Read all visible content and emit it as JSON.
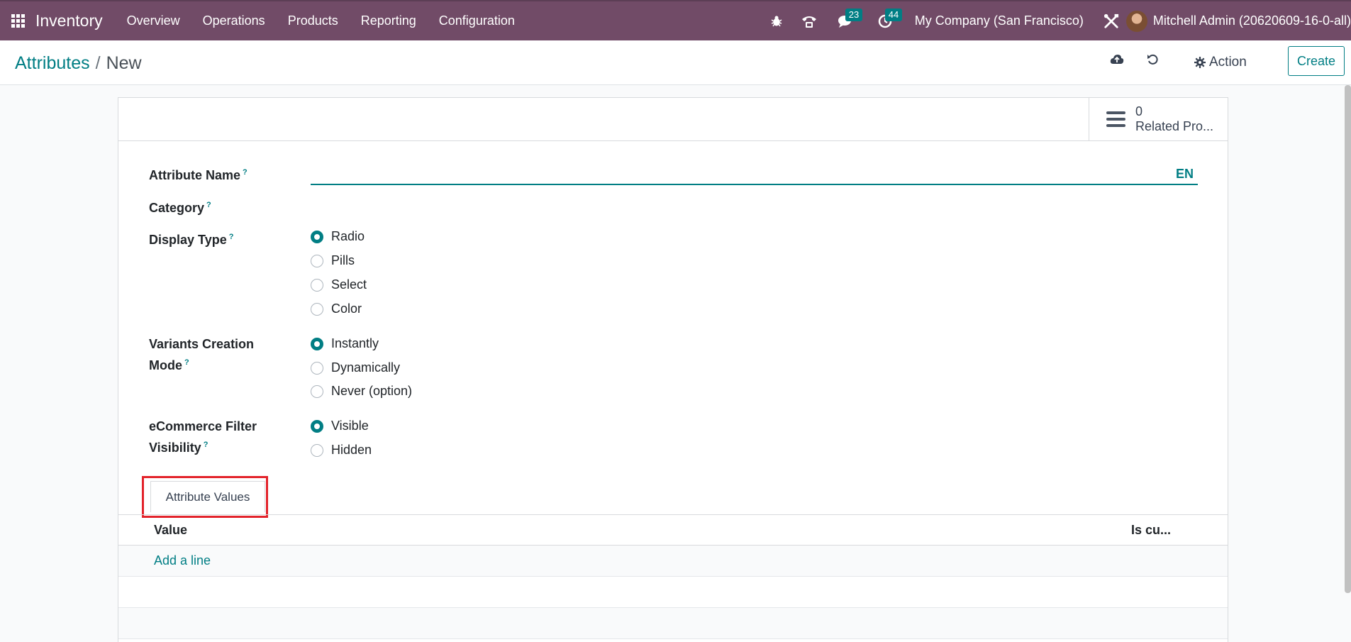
{
  "navbar": {
    "app_name": "Inventory",
    "menu": [
      "Overview",
      "Operations",
      "Products",
      "Reporting",
      "Configuration"
    ],
    "messages_count": "23",
    "activities_count": "44",
    "company": "My Company (San Francisco)",
    "user": "Mitchell Admin (20620609-16-0-all)"
  },
  "control_panel": {
    "breadcrumb_parent": "Attributes",
    "breadcrumb_separator": "/",
    "breadcrumb_current": "New",
    "action_label": "Action",
    "create_label": "Create"
  },
  "smart_button": {
    "count": "0",
    "label": "Related Pro..."
  },
  "form": {
    "attribute_name_label": "Attribute Name",
    "help_mark": "?",
    "lang": "EN",
    "category_label": "Category",
    "display_type_label": "Display Type",
    "display_type_options": [
      "Radio",
      "Pills",
      "Select",
      "Color"
    ],
    "display_type_selected": "Radio",
    "variants_label_line1": "Variants Creation",
    "variants_label_line2": "Mode",
    "variants_options": [
      "Instantly",
      "Dynamically",
      "Never (option)"
    ],
    "variants_selected": "Instantly",
    "ecommerce_label_line1": "eCommerce Filter",
    "ecommerce_label_line2": "Visibility",
    "ecommerce_options": [
      "Visible",
      "Hidden"
    ],
    "ecommerce_selected": "Visible"
  },
  "tabs": {
    "attribute_values": "Attribute Values"
  },
  "list": {
    "columns": [
      "Value",
      "Is cu..."
    ],
    "add_line": "Add a line"
  },
  "colors": {
    "navbar": "#714b67",
    "accent": "#017e84",
    "highlight": "#e3232b"
  }
}
